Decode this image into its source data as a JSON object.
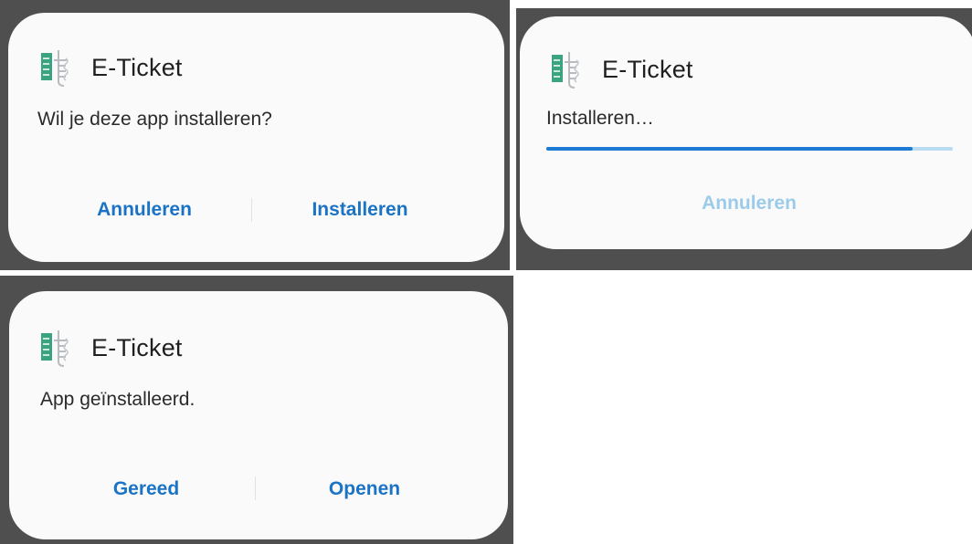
{
  "app": {
    "name": "E-Ticket",
    "icon": "e-ticket-app-icon"
  },
  "dialog_install": {
    "message": "Wil je deze app installeren?",
    "cancel_label": "Annuleren",
    "install_label": "Installeren"
  },
  "dialog_progress": {
    "message": "Installeren…",
    "progress": 0.9,
    "cancel_label": "Annuleren"
  },
  "dialog_done": {
    "message": "App geïnstalleerd.",
    "done_label": "Gereed",
    "open_label": "Openen"
  },
  "colors": {
    "accent": "#1a73c4",
    "disabled_accent": "#9ccbea",
    "progress_fill": "#1a7ad4",
    "progress_track": "#b9dcf3",
    "backdrop": "#4f4f4f",
    "icon_green": "#3aa37f"
  }
}
